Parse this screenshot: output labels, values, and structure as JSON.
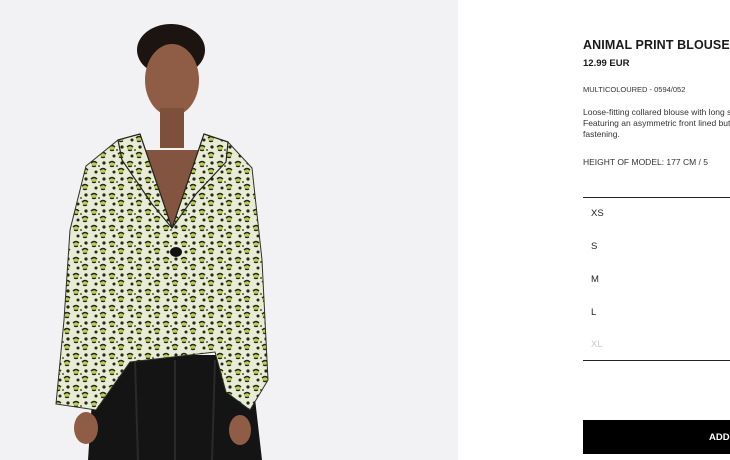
{
  "product": {
    "title": "ANIMAL PRINT BLOUSE",
    "price": "12.99 EUR",
    "colour_ref": "MULTICOLOURED - 0594/052",
    "description": "Loose-fitting collared blouse with long sleeves. Featuring an asymmetric front lined button fastening.",
    "model_height": "HEIGHT OF MODEL: 177 CM / 5",
    "sizes": [
      {
        "label": "XS",
        "available": true
      },
      {
        "label": "S",
        "available": true
      },
      {
        "label": "M",
        "available": true
      },
      {
        "label": "L",
        "available": true
      },
      {
        "label": "XL",
        "available": false
      }
    ],
    "add_button_label": "ADD"
  },
  "colors": {
    "photo_bg": "#f2f2f4",
    "print_base": "#e9ecd4",
    "print_lime": "#b9cf5a",
    "print_dark": "#23261c",
    "trousers": "#141414",
    "skin": "#8f5d45"
  }
}
